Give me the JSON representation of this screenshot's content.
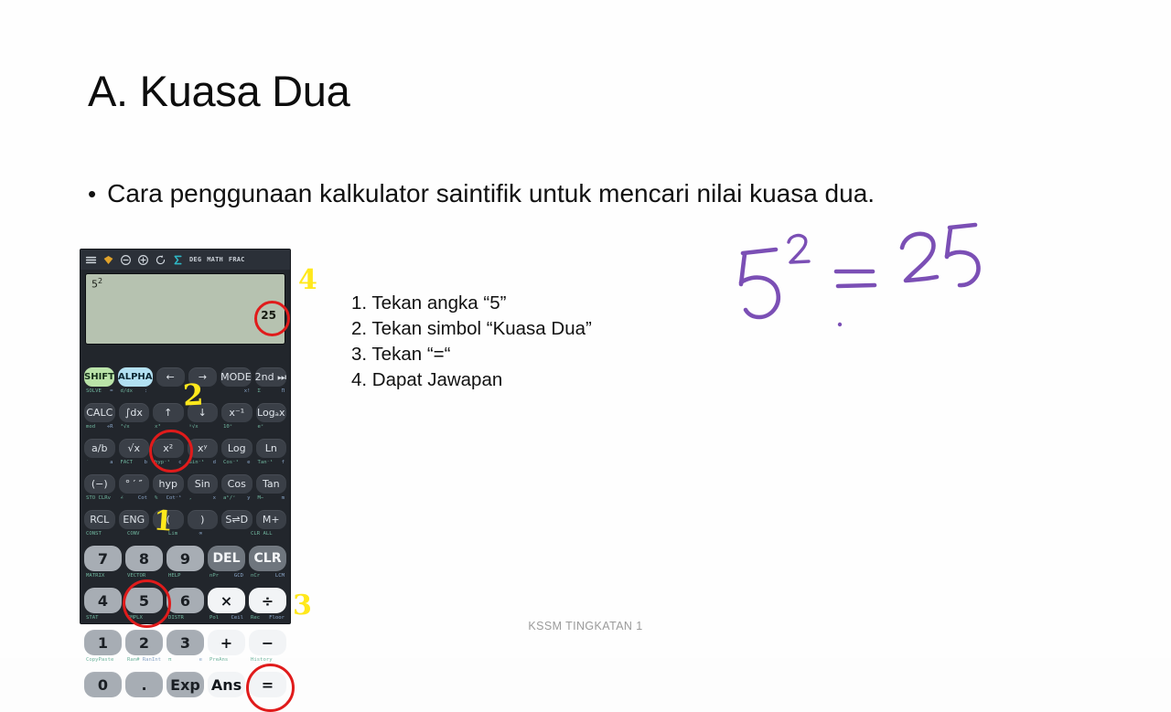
{
  "slide": {
    "title": "A. Kuasa Dua",
    "bullet_marker": "•",
    "bullet_text": "Cara penggunaan kalkulator saintifik untuk mencari nilai kuasa dua.",
    "footer": "KSSM TINGKATAN 1",
    "background_color": "#fefefe",
    "text_color": "#111111",
    "footer_color": "#9b9b9b"
  },
  "steps": [
    "1. Tekan angka “5”",
    "2. Tekan simbol “Kuasa Dua”",
    "3. Tekan “=“",
    "4. Dapat Jawapan"
  ],
  "handwriting": {
    "content": "5² = 25",
    "color": "#7b4fb5"
  },
  "annotations": {
    "circle_color": "#e01b1b",
    "number_color": "#ffe81c",
    "numbers": [
      {
        "label": "1",
        "target": "key-5"
      },
      {
        "label": "2",
        "target": "key-x-squared"
      },
      {
        "label": "3",
        "target": "key-equals"
      },
      {
        "label": "4",
        "target": "display-result"
      }
    ]
  },
  "calculator": {
    "toolbar": {
      "icons": [
        "menu-icon",
        "gem-icon",
        "minus-circle-icon",
        "plus-circle-icon",
        "refresh-icon",
        "sigma-icon"
      ],
      "modes": [
        "DEG",
        "MATH",
        "FRAC"
      ]
    },
    "display": {
      "expression_base": "5",
      "expression_exponent": "2",
      "result": "25",
      "background_color": "#b6c2b0"
    },
    "rows": [
      {
        "subs": [
          {
            "l": "",
            "r": ""
          },
          {
            "l": "",
            "r": ""
          },
          {
            "l": "",
            "r": ""
          },
          {
            "l": "",
            "r": ""
          },
          {
            "l": "",
            "r": ""
          },
          {
            "l": "",
            "r": ""
          }
        ],
        "keys": [
          {
            "label": "SHIFT",
            "style": "shift",
            "name": "key-shift"
          },
          {
            "label": "ALPHA",
            "style": "alpha",
            "name": "key-alpha"
          },
          {
            "label": "←",
            "style": "",
            "name": "key-left"
          },
          {
            "label": "→",
            "style": "",
            "name": "key-right"
          },
          {
            "label": "MODE",
            "style": "",
            "name": "key-mode"
          },
          {
            "label": "2nd ⏭",
            "style": "",
            "name": "key-2nd"
          }
        ]
      },
      {
        "subs": [
          {
            "l": "SOLVE",
            "r": "="
          },
          {
            "l": "d/dx",
            "r": ":"
          },
          {
            "l": "",
            "r": ""
          },
          {
            "l": "",
            "r": ""
          },
          {
            "l": "",
            "r": "x!"
          },
          {
            "l": "Σ",
            "r": "Π"
          }
        ],
        "keys": [
          {
            "label": "CALC",
            "style": "",
            "name": "key-calc"
          },
          {
            "label": "∫dx",
            "style": "",
            "name": "key-integral"
          },
          {
            "label": "↑",
            "style": "",
            "name": "key-up"
          },
          {
            "label": "↓",
            "style": "",
            "name": "key-down"
          },
          {
            "label": "x⁻¹",
            "style": "",
            "name": "key-inverse"
          },
          {
            "label": "Logₐx",
            "style": "",
            "name": "key-log-base"
          }
        ]
      },
      {
        "subs": [
          {
            "l": "mod",
            "r": "÷R"
          },
          {
            "l": "³√x",
            "r": ""
          },
          {
            "l": "x³",
            "r": ""
          },
          {
            "l": "ʸ√x",
            "r": ""
          },
          {
            "l": "10ˣ",
            "r": ""
          },
          {
            "l": "eˣ",
            "r": ""
          }
        ],
        "keys": [
          {
            "label": "a/b",
            "style": "",
            "name": "key-fraction"
          },
          {
            "label": "√x",
            "style": "",
            "name": "key-sqrt"
          },
          {
            "label": "x²",
            "style": "",
            "name": "key-x-squared"
          },
          {
            "label": "xʸ",
            "style": "",
            "name": "key-power"
          },
          {
            "label": "Log",
            "style": "",
            "name": "key-log"
          },
          {
            "label": "Ln",
            "style": "",
            "name": "key-ln"
          }
        ]
      },
      {
        "subs": [
          {
            "l": "´",
            "r": "a"
          },
          {
            "l": "FACT",
            "r": "b"
          },
          {
            "l": "hyp⁻¹",
            "r": "c"
          },
          {
            "l": "Sin⁻¹",
            "r": "d"
          },
          {
            "l": "Cos⁻¹",
            "r": "e"
          },
          {
            "l": "Tan⁻¹",
            "r": "f"
          }
        ],
        "keys": [
          {
            "label": "(−)",
            "style": "",
            "name": "key-negative"
          },
          {
            "label": "° ′ ″",
            "style": "",
            "name": "key-degree"
          },
          {
            "label": "hyp",
            "style": "",
            "name": "key-hyp"
          },
          {
            "label": "Sin",
            "style": "",
            "name": "key-sin"
          },
          {
            "label": "Cos",
            "style": "",
            "name": "key-cos"
          },
          {
            "label": "Tan",
            "style": "",
            "name": "key-tan"
          }
        ]
      },
      {
        "subs": [
          {
            "l": "STO CLRv",
            "r": ""
          },
          {
            "l": "∠",
            "r": "Cot"
          },
          {
            "l": "%",
            "r": "Cot⁻¹"
          },
          {
            "l": ",",
            "r": "x"
          },
          {
            "l": "aᵇ/ᶜ",
            "r": "y"
          },
          {
            "l": "M−",
            "r": "m"
          }
        ],
        "keys": [
          {
            "label": "RCL",
            "style": "",
            "name": "key-rcl"
          },
          {
            "label": "ENG",
            "style": "",
            "name": "key-eng"
          },
          {
            "label": "(",
            "style": "",
            "name": "key-paren-open"
          },
          {
            "label": ")",
            "style": "",
            "name": "key-paren-close"
          },
          {
            "label": "S⇌D",
            "style": "",
            "name": "key-s-d"
          },
          {
            "label": "M+",
            "style": "",
            "name": "key-m-plus"
          }
        ]
      },
      {
        "subs": [
          {
            "l": "CONST",
            "r": ""
          },
          {
            "l": "CONV",
            "r": ""
          },
          {
            "l": "Lim",
            "r": "∞"
          },
          {
            "l": "",
            "r": ""
          },
          {
            "l": "CLR ALL",
            "r": ""
          }
        ],
        "keys": [
          {
            "label": "7",
            "style": "num",
            "name": "key-7"
          },
          {
            "label": "8",
            "style": "num",
            "name": "key-8"
          },
          {
            "label": "9",
            "style": "num",
            "name": "key-9"
          },
          {
            "label": "DEL",
            "style": "dark-op",
            "name": "key-del"
          },
          {
            "label": "CLR",
            "style": "dark-op",
            "name": "key-clr"
          }
        ]
      },
      {
        "subs": [
          {
            "l": "MATRIX",
            "r": ""
          },
          {
            "l": "VECTOR",
            "r": ""
          },
          {
            "l": "HELP",
            "r": ""
          },
          {
            "l": "nPr",
            "r": "GCD"
          },
          {
            "l": "nCr",
            "r": "LCM"
          }
        ],
        "keys": [
          {
            "label": "4",
            "style": "num",
            "name": "key-4"
          },
          {
            "label": "5",
            "style": "num",
            "name": "key-5"
          },
          {
            "label": "6",
            "style": "num",
            "name": "key-6"
          },
          {
            "label": "×",
            "style": "op",
            "name": "key-multiply"
          },
          {
            "label": "÷",
            "style": "op",
            "name": "key-divide"
          }
        ]
      },
      {
        "subs": [
          {
            "l": "STAT",
            "r": ""
          },
          {
            "l": "CMPLX",
            "r": ""
          },
          {
            "l": "DISTR",
            "r": ""
          },
          {
            "l": "Pol",
            "r": "Ceil"
          },
          {
            "l": "Rec",
            "r": "Floor"
          }
        ],
        "keys": [
          {
            "label": "1",
            "style": "num",
            "name": "key-1"
          },
          {
            "label": "2",
            "style": "num",
            "name": "key-2"
          },
          {
            "label": "3",
            "style": "num",
            "name": "key-3"
          },
          {
            "label": "+",
            "style": "op",
            "name": "key-plus"
          },
          {
            "label": "−",
            "style": "op",
            "name": "key-minus"
          }
        ]
      },
      {
        "subs": [
          {
            "l": "CopyPaste",
            "r": ""
          },
          {
            "l": "Ran#",
            "r": "RanInt"
          },
          {
            "l": "π",
            "r": "e"
          },
          {
            "l": "PreAns",
            "r": ""
          },
          {
            "l": "History",
            "r": ""
          }
        ],
        "keys": [
          {
            "label": "0",
            "style": "num",
            "name": "key-0"
          },
          {
            "label": ".",
            "style": "num",
            "name": "key-decimal"
          },
          {
            "label": "Exp",
            "style": "num",
            "name": "key-exp"
          },
          {
            "label": "Ans",
            "style": "op",
            "name": "key-ans"
          },
          {
            "label": "=",
            "style": "op",
            "name": "key-equals"
          }
        ]
      }
    ]
  }
}
